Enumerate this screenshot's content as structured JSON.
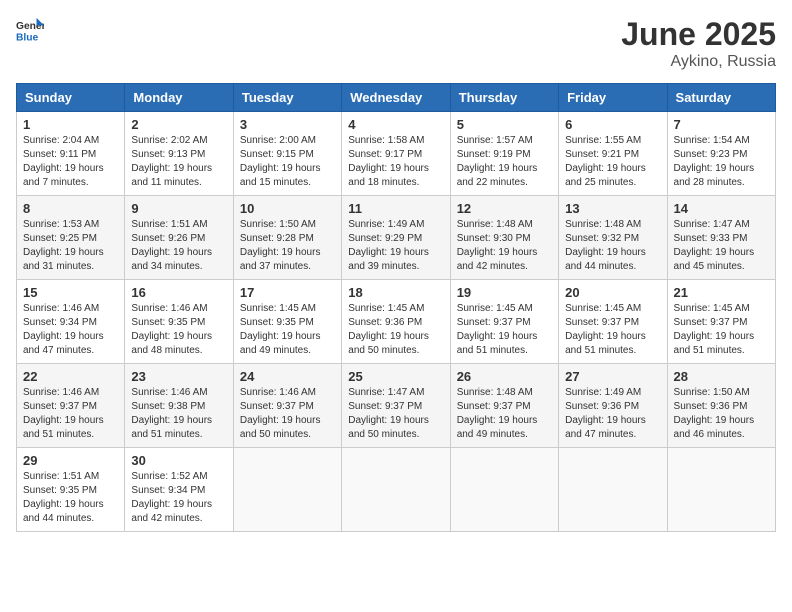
{
  "logo": {
    "general": "General",
    "blue": "Blue"
  },
  "title": "June 2025",
  "subtitle": "Aykino, Russia",
  "weekdays": [
    "Sunday",
    "Monday",
    "Tuesday",
    "Wednesday",
    "Thursday",
    "Friday",
    "Saturday"
  ],
  "weeks": [
    [
      {
        "day": "1",
        "sunrise": "Sunrise: 2:04 AM",
        "sunset": "Sunset: 9:11 PM",
        "daylight": "Daylight: 19 hours and 7 minutes."
      },
      {
        "day": "2",
        "sunrise": "Sunrise: 2:02 AM",
        "sunset": "Sunset: 9:13 PM",
        "daylight": "Daylight: 19 hours and 11 minutes."
      },
      {
        "day": "3",
        "sunrise": "Sunrise: 2:00 AM",
        "sunset": "Sunset: 9:15 PM",
        "daylight": "Daylight: 19 hours and 15 minutes."
      },
      {
        "day": "4",
        "sunrise": "Sunrise: 1:58 AM",
        "sunset": "Sunset: 9:17 PM",
        "daylight": "Daylight: 19 hours and 18 minutes."
      },
      {
        "day": "5",
        "sunrise": "Sunrise: 1:57 AM",
        "sunset": "Sunset: 9:19 PM",
        "daylight": "Daylight: 19 hours and 22 minutes."
      },
      {
        "day": "6",
        "sunrise": "Sunrise: 1:55 AM",
        "sunset": "Sunset: 9:21 PM",
        "daylight": "Daylight: 19 hours and 25 minutes."
      },
      {
        "day": "7",
        "sunrise": "Sunrise: 1:54 AM",
        "sunset": "Sunset: 9:23 PM",
        "daylight": "Daylight: 19 hours and 28 minutes."
      }
    ],
    [
      {
        "day": "8",
        "sunrise": "Sunrise: 1:53 AM",
        "sunset": "Sunset: 9:25 PM",
        "daylight": "Daylight: 19 hours and 31 minutes."
      },
      {
        "day": "9",
        "sunrise": "Sunrise: 1:51 AM",
        "sunset": "Sunset: 9:26 PM",
        "daylight": "Daylight: 19 hours and 34 minutes."
      },
      {
        "day": "10",
        "sunrise": "Sunrise: 1:50 AM",
        "sunset": "Sunset: 9:28 PM",
        "daylight": "Daylight: 19 hours and 37 minutes."
      },
      {
        "day": "11",
        "sunrise": "Sunrise: 1:49 AM",
        "sunset": "Sunset: 9:29 PM",
        "daylight": "Daylight: 19 hours and 39 minutes."
      },
      {
        "day": "12",
        "sunrise": "Sunrise: 1:48 AM",
        "sunset": "Sunset: 9:30 PM",
        "daylight": "Daylight: 19 hours and 42 minutes."
      },
      {
        "day": "13",
        "sunrise": "Sunrise: 1:48 AM",
        "sunset": "Sunset: 9:32 PM",
        "daylight": "Daylight: 19 hours and 44 minutes."
      },
      {
        "day": "14",
        "sunrise": "Sunrise: 1:47 AM",
        "sunset": "Sunset: 9:33 PM",
        "daylight": "Daylight: 19 hours and 45 minutes."
      }
    ],
    [
      {
        "day": "15",
        "sunrise": "Sunrise: 1:46 AM",
        "sunset": "Sunset: 9:34 PM",
        "daylight": "Daylight: 19 hours and 47 minutes."
      },
      {
        "day": "16",
        "sunrise": "Sunrise: 1:46 AM",
        "sunset": "Sunset: 9:35 PM",
        "daylight": "Daylight: 19 hours and 48 minutes."
      },
      {
        "day": "17",
        "sunrise": "Sunrise: 1:45 AM",
        "sunset": "Sunset: 9:35 PM",
        "daylight": "Daylight: 19 hours and 49 minutes."
      },
      {
        "day": "18",
        "sunrise": "Sunrise: 1:45 AM",
        "sunset": "Sunset: 9:36 PM",
        "daylight": "Daylight: 19 hours and 50 minutes."
      },
      {
        "day": "19",
        "sunrise": "Sunrise: 1:45 AM",
        "sunset": "Sunset: 9:37 PM",
        "daylight": "Daylight: 19 hours and 51 minutes."
      },
      {
        "day": "20",
        "sunrise": "Sunrise: 1:45 AM",
        "sunset": "Sunset: 9:37 PM",
        "daylight": "Daylight: 19 hours and 51 minutes."
      },
      {
        "day": "21",
        "sunrise": "Sunrise: 1:45 AM",
        "sunset": "Sunset: 9:37 PM",
        "daylight": "Daylight: 19 hours and 51 minutes."
      }
    ],
    [
      {
        "day": "22",
        "sunrise": "Sunrise: 1:46 AM",
        "sunset": "Sunset: 9:37 PM",
        "daylight": "Daylight: 19 hours and 51 minutes."
      },
      {
        "day": "23",
        "sunrise": "Sunrise: 1:46 AM",
        "sunset": "Sunset: 9:38 PM",
        "daylight": "Daylight: 19 hours and 51 minutes."
      },
      {
        "day": "24",
        "sunrise": "Sunrise: 1:46 AM",
        "sunset": "Sunset: 9:37 PM",
        "daylight": "Daylight: 19 hours and 50 minutes."
      },
      {
        "day": "25",
        "sunrise": "Sunrise: 1:47 AM",
        "sunset": "Sunset: 9:37 PM",
        "daylight": "Daylight: 19 hours and 50 minutes."
      },
      {
        "day": "26",
        "sunrise": "Sunrise: 1:48 AM",
        "sunset": "Sunset: 9:37 PM",
        "daylight": "Daylight: 19 hours and 49 minutes."
      },
      {
        "day": "27",
        "sunrise": "Sunrise: 1:49 AM",
        "sunset": "Sunset: 9:36 PM",
        "daylight": "Daylight: 19 hours and 47 minutes."
      },
      {
        "day": "28",
        "sunrise": "Sunrise: 1:50 AM",
        "sunset": "Sunset: 9:36 PM",
        "daylight": "Daylight: 19 hours and 46 minutes."
      }
    ],
    [
      {
        "day": "29",
        "sunrise": "Sunrise: 1:51 AM",
        "sunset": "Sunset: 9:35 PM",
        "daylight": "Daylight: 19 hours and 44 minutes."
      },
      {
        "day": "30",
        "sunrise": "Sunrise: 1:52 AM",
        "sunset": "Sunset: 9:34 PM",
        "daylight": "Daylight: 19 hours and 42 minutes."
      },
      null,
      null,
      null,
      null,
      null
    ]
  ]
}
